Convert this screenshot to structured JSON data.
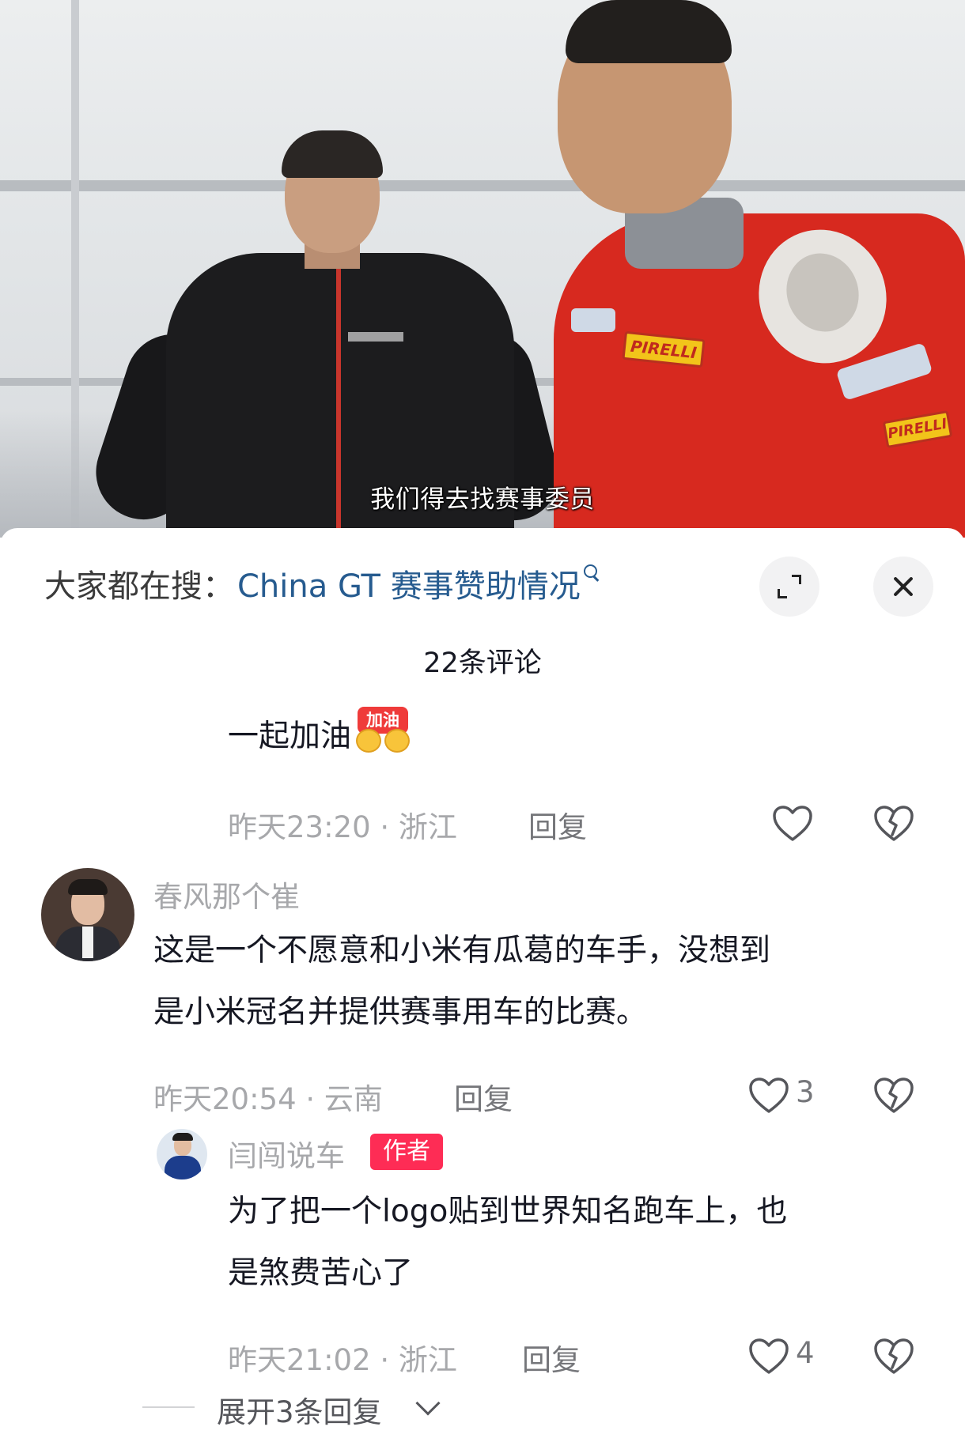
{
  "video": {
    "subtitle": "我们得去找赛事委员",
    "patch_text": "PIRELLI"
  },
  "search_bar": {
    "prefix": "大家都在搜：",
    "query": "China GT 赛事赞助情况"
  },
  "comments_header": {
    "count_label": "22条评论"
  },
  "comments": [
    {
      "text": "一起加油",
      "emoji_label": "加油",
      "time": "昨天23:20 · 浙江",
      "reply_label": "回复"
    },
    {
      "username": "春风那个崔",
      "text_line1": "这是一个不愿意和小米有瓜葛的车手，没想到",
      "text_line2": "是小米冠名并提供赛事用车的比赛。",
      "time": "昨天20:54 · 云南",
      "reply_label": "回复",
      "likes": "3"
    },
    {
      "username": "闫闯说车",
      "badge": "作者",
      "text_line1": "为了把一个logo贴到世界知名跑车上，也",
      "text_line2": "是煞费苦心了",
      "time": "昨天21:02 · 浙江",
      "reply_label": "回复",
      "likes": "4"
    }
  ],
  "expand_replies": {
    "label": "展开3条回复"
  },
  "colors": {
    "link": "#265b8f",
    "author_badge": "#fe2c55",
    "muted_text": "#a7a8ab"
  }
}
